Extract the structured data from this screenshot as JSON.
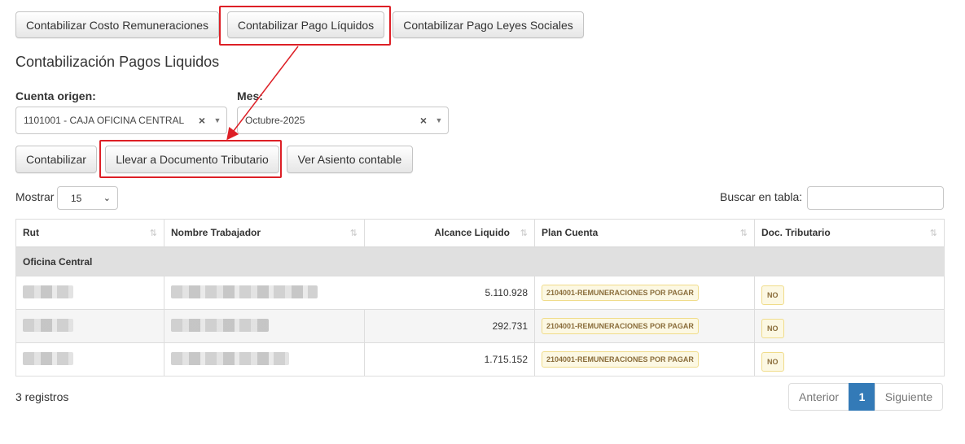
{
  "tabs": {
    "costo_label": "Contabilizar Costo Remuneraciones",
    "pago_label": "Contabilizar Pago Líquidos",
    "leyes_label": "Contabilizar Pago Leyes Sociales"
  },
  "page_title": "Contabilización Pagos Liquidos",
  "filters": {
    "cuenta_label": "Cuenta origen:",
    "cuenta_value": "1101001 - CAJA OFICINA CENTRAL",
    "mes_label": "Mes:",
    "mes_value": "Octubre-2025"
  },
  "actions": {
    "contabilizar_label": "Contabilizar",
    "llevar_label": "Llevar a Documento Tributario",
    "ver_label": "Ver Asiento contable"
  },
  "table_controls": {
    "mostrar_label": "Mostrar",
    "page_length": "15",
    "buscar_label": "Buscar en tabla:"
  },
  "table": {
    "headers": [
      "Rut",
      "Nombre Trabajador",
      "Alcance Liquido",
      "Plan Cuenta",
      "Doc. Tributario"
    ],
    "group": "Oficina Central",
    "rows": [
      {
        "alcance": "5.110.928",
        "plan": "2104001-REMUNERACIONES POR PAGAR",
        "doc": "NO"
      },
      {
        "alcance": "292.731",
        "plan": "2104001-REMUNERACIONES POR PAGAR",
        "doc": "NO"
      },
      {
        "alcance": "1.715.152",
        "plan": "2104001-REMUNERACIONES POR PAGAR",
        "doc": "NO"
      }
    ]
  },
  "footer": {
    "info": "3 registros",
    "prev_label": "Anterior",
    "current_page": "1",
    "next_label": "Siguiente"
  },
  "colors": {
    "highlight": "#dd1f26",
    "active_page": "#337ab7",
    "badge_bg": "#fcf8e3",
    "group_row": "#e0e0e0"
  }
}
